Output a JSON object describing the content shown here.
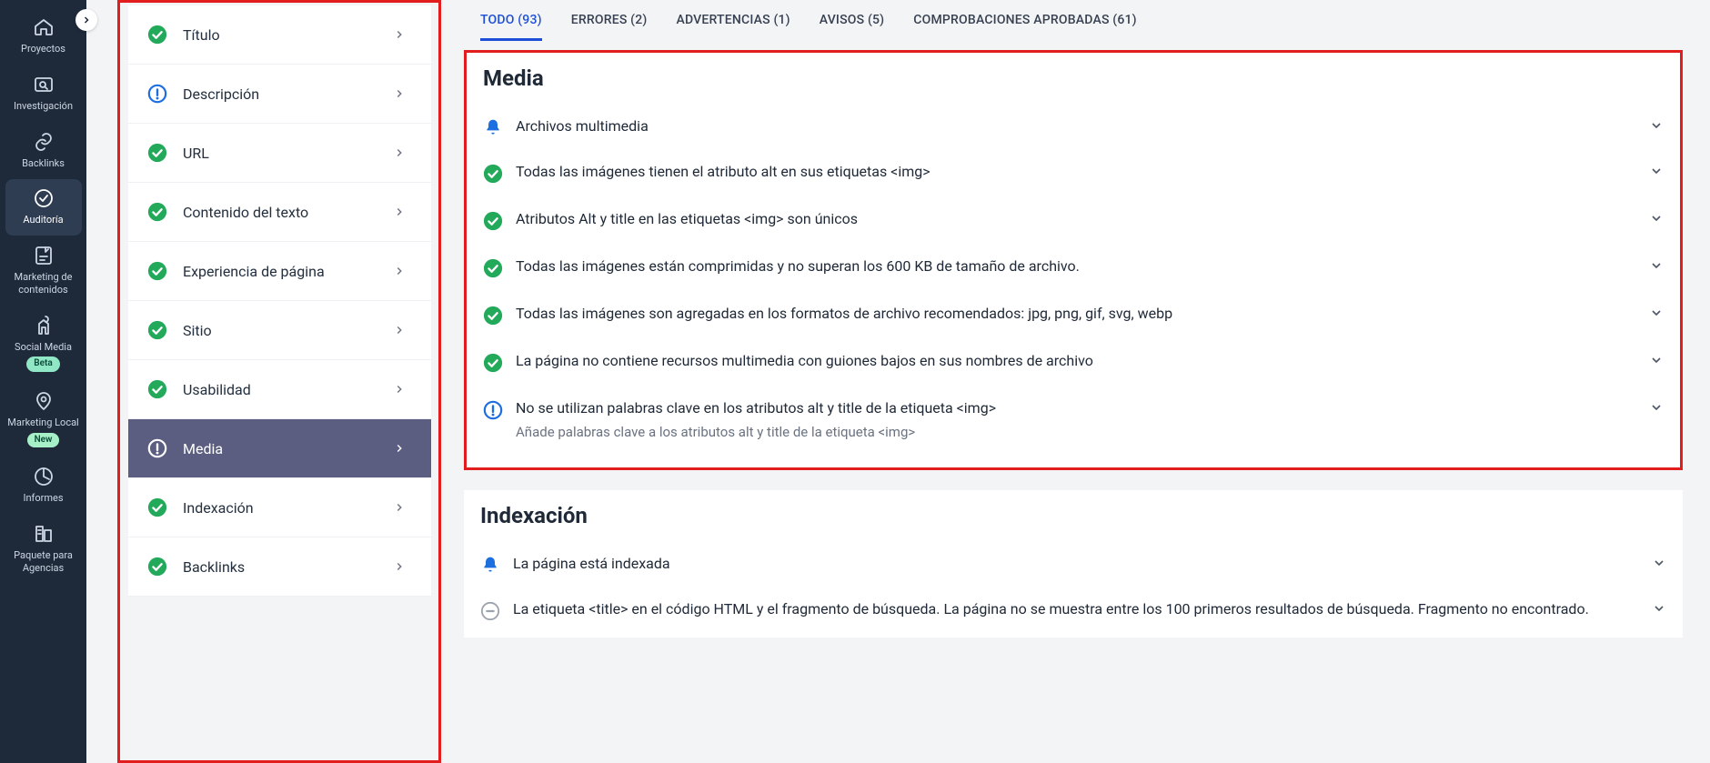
{
  "leftnav": {
    "items": [
      {
        "id": "proyectos",
        "label": "Proyectos"
      },
      {
        "id": "investigacion",
        "label": "Investigación"
      },
      {
        "id": "backlinks",
        "label": "Backlinks"
      },
      {
        "id": "auditoria",
        "label": "Auditoría"
      },
      {
        "id": "marketing-contenidos",
        "label": "Marketing de contenidos"
      },
      {
        "id": "social-media",
        "label": "Social Media",
        "badge": "Beta"
      },
      {
        "id": "marketing-local",
        "label": "Marketing Local",
        "badge": "New"
      },
      {
        "id": "informes",
        "label": "Informes"
      },
      {
        "id": "paquete-agencias",
        "label": "Paquete para Agencias"
      }
    ]
  },
  "sidebar": {
    "items": [
      {
        "id": "titulo",
        "label": "Título",
        "status": "ok"
      },
      {
        "id": "descripcion",
        "label": "Descripción",
        "status": "info"
      },
      {
        "id": "url",
        "label": "URL",
        "status": "ok"
      },
      {
        "id": "contenido-texto",
        "label": "Contenido del texto",
        "status": "ok"
      },
      {
        "id": "experiencia-pagina",
        "label": "Experiencia de página",
        "status": "ok"
      },
      {
        "id": "sitio",
        "label": "Sitio",
        "status": "ok"
      },
      {
        "id": "usabilidad",
        "label": "Usabilidad",
        "status": "ok"
      },
      {
        "id": "media",
        "label": "Media",
        "status": "info",
        "selected": true
      },
      {
        "id": "indexacion",
        "label": "Indexación",
        "status": "ok"
      },
      {
        "id": "backlinks-s",
        "label": "Backlinks",
        "status": "ok"
      }
    ]
  },
  "tabs": [
    {
      "id": "todo",
      "label": "TODO (93)",
      "active": true
    },
    {
      "id": "errores",
      "label": "ERRORES (2)"
    },
    {
      "id": "advertencias",
      "label": "ADVERTENCIAS (1)"
    },
    {
      "id": "avisos",
      "label": "AVISOS (5)"
    },
    {
      "id": "aprobadas",
      "label": "COMPROBACIONES APROBADAS (61)"
    }
  ],
  "sections": {
    "media": {
      "heading": "Media",
      "rows": [
        {
          "icon": "bell",
          "text": "Archivos multimedia"
        },
        {
          "icon": "ok",
          "text": "Todas las imágenes tienen el atributo alt en sus etiquetas <img>"
        },
        {
          "icon": "ok",
          "text": "Atributos Alt y title en las etiquetas <img> son únicos"
        },
        {
          "icon": "ok",
          "text": "Todas las imágenes están comprimidas y no superan los 600 KB de tamaño de archivo."
        },
        {
          "icon": "ok",
          "text": "Todas las imágenes son agregadas en los formatos de archivo recomendados: jpg, png, gif, svg, webp"
        },
        {
          "icon": "ok",
          "text": "La página no contiene recursos multimedia con guiones bajos en sus nombres de archivo"
        },
        {
          "icon": "info",
          "text": "No se utilizan palabras clave en los atributos alt y title de la etiqueta <img>",
          "sub": "Añade palabras clave a los atributos alt y title de la etiqueta <img>"
        }
      ]
    },
    "indexacion": {
      "heading": "Indexación",
      "rows": [
        {
          "icon": "bell",
          "text": "La página está indexada"
        },
        {
          "icon": "dash",
          "text": "La etiqueta <title> en el código HTML y el fragmento de búsqueda. La página no se muestra entre los 100 primeros resultados de búsqueda. Fragmento no encontrado."
        }
      ]
    }
  }
}
